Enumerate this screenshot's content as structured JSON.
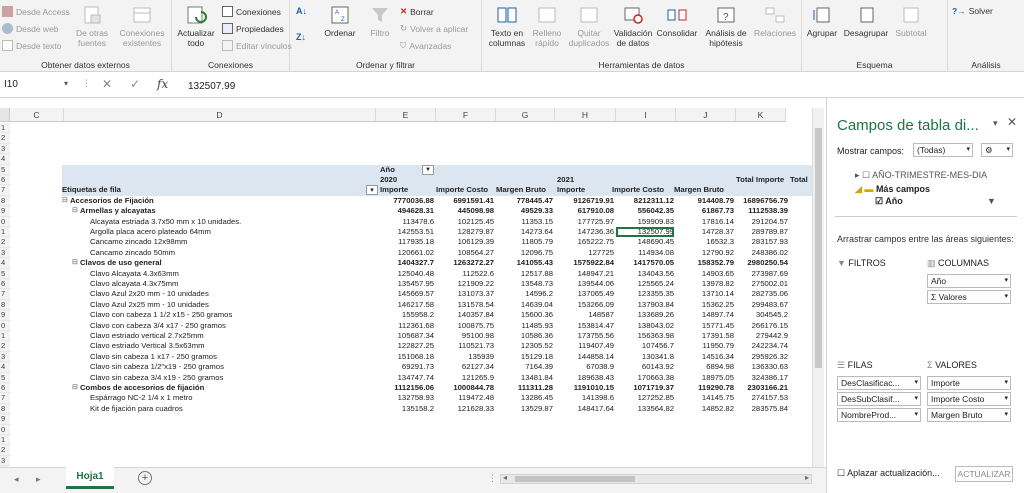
{
  "ribbon": {
    "get_data": {
      "desde_access": "Desde Access",
      "desde_web": "Desde web",
      "desde_texto": "Desde texto",
      "de_otras_line1": "De otras",
      "de_otras_line2": "fuentes",
      "conexiones_exist_line1": "Conexiones",
      "conexiones_exist_line2": "existentes",
      "group_label": "Obtener datos externos"
    },
    "connections": {
      "actualizar_line1": "Actualizar",
      "actualizar_line2": "todo",
      "conexiones": "Conexiones",
      "propiedades": "Propiedades",
      "editar_vinculos": "Editar vínculos",
      "group_label": "Conexiones"
    },
    "sort_filter": {
      "ordenar": "Ordenar",
      "filtro": "Filtro",
      "borrar": "Borrar",
      "volver_aplicar": "Volver a aplicar",
      "avanzadas": "Avanzadas",
      "group_label": "Ordenar y filtrar"
    },
    "data_tools": {
      "texto_col_line1": "Texto en",
      "texto_col_line2": "columnas",
      "relleno_line1": "Relleno",
      "relleno_line2": "rápido",
      "quitar_line1": "Quitar",
      "quitar_line2": "duplicados",
      "validacion_line1": "Validación",
      "validacion_line2": "de datos",
      "consolidar": "Consolidar",
      "analisis_line1": "Análisis de",
      "analisis_line2": "hipótesis",
      "relaciones": "Relaciones",
      "group_label": "Herramientas de datos"
    },
    "outline": {
      "agrupar": "Agrupar",
      "desagrupar": "Desagrupar",
      "subtotal": "Subtotal",
      "group_label": "Esquema"
    },
    "analysis": {
      "solver": "Solver",
      "group_label": "Análisis"
    }
  },
  "formula_bar": {
    "name_box": "I10",
    "fx": "fx",
    "value": "132507.99"
  },
  "columns": [
    "C",
    "D",
    "E",
    "F",
    "G",
    "H",
    "I",
    "J",
    "K"
  ],
  "row_numbers": [
    "1",
    "2",
    "3",
    "4",
    "5",
    "6",
    "7",
    "8",
    "9",
    "0",
    "1",
    "2",
    "3",
    "4",
    "5",
    "6",
    "7",
    "8",
    "9",
    "0",
    "1",
    "2",
    "3",
    "4",
    "5",
    "6",
    "7",
    "8",
    "9",
    "0",
    "1",
    "2",
    "3",
    "4",
    "5"
  ],
  "pivot": {
    "header_anio": "Año",
    "header_2020": "2020",
    "header_2021": "2021",
    "total_importe_top": "Total Importe",
    "total_trunc": "Total",
    "etiquetas": "Etiquetas de fila",
    "col_importe": "Importe",
    "col_importe_costo": "Importe Costo",
    "col_margen_bruto": "Margen Bruto",
    "rows": [
      {
        "label": "Accesorios de Fijación",
        "level": 0,
        "v": [
          "7770036.88",
          "6991591.41",
          "778445.47",
          "9126719.91",
          "8212311.12",
          "914408.79",
          "16896756.79"
        ]
      },
      {
        "label": "Armellas y alcayatas",
        "level": 1,
        "v": [
          "494628.31",
          "445098.98",
          "49529.33",
          "617910.08",
          "556042.35",
          "61867.73",
          "1112538.39"
        ]
      },
      {
        "label": "Alcayata estriada 3.7x50 mm x 10 unidades.",
        "level": 2,
        "v": [
          "113478.6",
          "102125.45",
          "11353.15",
          "177725.97",
          "159909.83",
          "17816.14",
          "291204.57"
        ]
      },
      {
        "label": "Argolla placa acero plateado 64mm",
        "level": 2,
        "v": [
          "142553.51",
          "128279.87",
          "14273.64",
          "147236.36",
          "132507.99",
          "14728.37",
          "289789.87"
        ]
      },
      {
        "label": "Cancamo zincado 12x98mm",
        "level": 2,
        "v": [
          "117935.18",
          "106129.39",
          "11805.79",
          "165222.75",
          "148690.45",
          "16532.3",
          "283157.93"
        ]
      },
      {
        "label": "Cancamo zincado 50mm",
        "level": 2,
        "v": [
          "120661.02",
          "108564.27",
          "12096.75",
          "127725",
          "114934.08",
          "12790.92",
          "248386.02"
        ]
      },
      {
        "label": "Clavos de uso general",
        "level": 1,
        "v": [
          "1404327.7",
          "1263272.27",
          "141055.43",
          "1575922.84",
          "1417570.05",
          "158352.79",
          "2980250.54"
        ]
      },
      {
        "label": "Clavo Alcayata 4.3x63mm",
        "level": 2,
        "v": [
          "125040.48",
          "112522.6",
          "12517.88",
          "148947.21",
          "134043.56",
          "14903.65",
          "273987.69"
        ]
      },
      {
        "label": "Clavo alcayata 4.3x75mm",
        "level": 2,
        "v": [
          "135457.95",
          "121909.22",
          "13548.73",
          "139544.06",
          "125565.24",
          "13978.82",
          "275002.01"
        ]
      },
      {
        "label": "Clavo Azul 2x20 mm - 10 unidades",
        "level": 2,
        "v": [
          "145669.57",
          "131073.37",
          "14596.2",
          "137065.49",
          "123355.35",
          "13710.14",
          "282735.06"
        ]
      },
      {
        "label": "Clavo Azul 2x25 mm - 10 unidades",
        "level": 2,
        "v": [
          "146217.58",
          "131578.54",
          "14639.04",
          "153266.09",
          "137903.84",
          "15362.25",
          "299483.67"
        ]
      },
      {
        "label": "Clavo con cabeza 1 1/2 x15 - 250 gramos",
        "level": 2,
        "v": [
          "155958.2",
          "140357.84",
          "15600.36",
          "148587",
          "133689.26",
          "14897.74",
          "304545.2"
        ]
      },
      {
        "label": "Clavo con cabeza 3/4 x17 - 250 gramos",
        "level": 2,
        "v": [
          "112361.68",
          "100875.75",
          "11485.93",
          "153814.47",
          "138043.02",
          "15771.45",
          "266176.15"
        ]
      },
      {
        "label": "Clavo estriado vertical 2.7x25mm",
        "level": 2,
        "v": [
          "105687.34",
          "95100.98",
          "10586.36",
          "173755.56",
          "156363.98",
          "17391.58",
          "279442.9"
        ]
      },
      {
        "label": "Clavo estriado Vertical 3.5x63mm",
        "level": 2,
        "v": [
          "122827.25",
          "110521.73",
          "12305.52",
          "119407.49",
          "107456.7",
          "11950.79",
          "242234.74"
        ]
      },
      {
        "label": "Clavo sin cabeza 1 x17 - 250 gramos",
        "level": 2,
        "v": [
          "151068.18",
          "135939",
          "15129.18",
          "144858.14",
          "130341.8",
          "14516.34",
          "295926.32"
        ]
      },
      {
        "label": "Clavo sin cabeza 1/2\"x19 - 250 gramos",
        "level": 2,
        "v": [
          "69291.73",
          "62127.34",
          "7164.39",
          "67038.9",
          "60143.92",
          "6894.98",
          "136330.63"
        ]
      },
      {
        "label": "Clavo sin cabeza 3/4 x19 - 250 gramos",
        "level": 2,
        "v": [
          "134747.74",
          "121265.9",
          "13481.84",
          "189638.43",
          "170663.38",
          "18975.05",
          "324386.17"
        ]
      },
      {
        "label": "Combos de accesorios de fijación",
        "level": 1,
        "v": [
          "1112156.06",
          "1000844.78",
          "111311.28",
          "1191010.15",
          "1071719.37",
          "119290.78",
          "2303166.21"
        ]
      },
      {
        "label": "Espárrago NC-2 1/4 x 1 metro",
        "level": 2,
        "v": [
          "132758.93",
          "119472.48",
          "13286.45",
          "141398.6",
          "127252.85",
          "14145.75",
          "274157.53"
        ]
      },
      {
        "label": "Kit de fijación para cuadros",
        "level": 2,
        "v": [
          "135158.2",
          "121628.33",
          "13529.87",
          "148417.64",
          "133564.82",
          "14852.82",
          "283575.84"
        ]
      }
    ]
  },
  "sheet_tab": "Hoja1",
  "panel": {
    "title": "Campos de tabla di...",
    "mostrar_label": "Mostrar campos:",
    "mostrar_value": "(Todas)",
    "field_trunc": "AÑO-TRIMESTRE-MES-DIA",
    "mas_campos": "Más campos",
    "anio_field": "Año",
    "arrastrar": "Arrastrar campos entre las áreas siguientes:",
    "filtros": "FILTROS",
    "columnas": "COLUMNAS",
    "col_items": [
      "Año",
      "Σ Valores"
    ],
    "filas": "FILAS",
    "valores": "VALORES",
    "filas_items": [
      "DesClasificac...",
      "DesSubClasif...",
      "NombreProd..."
    ],
    "valores_items": [
      "Importe",
      "Importe Costo",
      "Margen Bruto"
    ],
    "aplazar": "Aplazar actualización...",
    "actualizar": "ACTUALIZAR"
  }
}
